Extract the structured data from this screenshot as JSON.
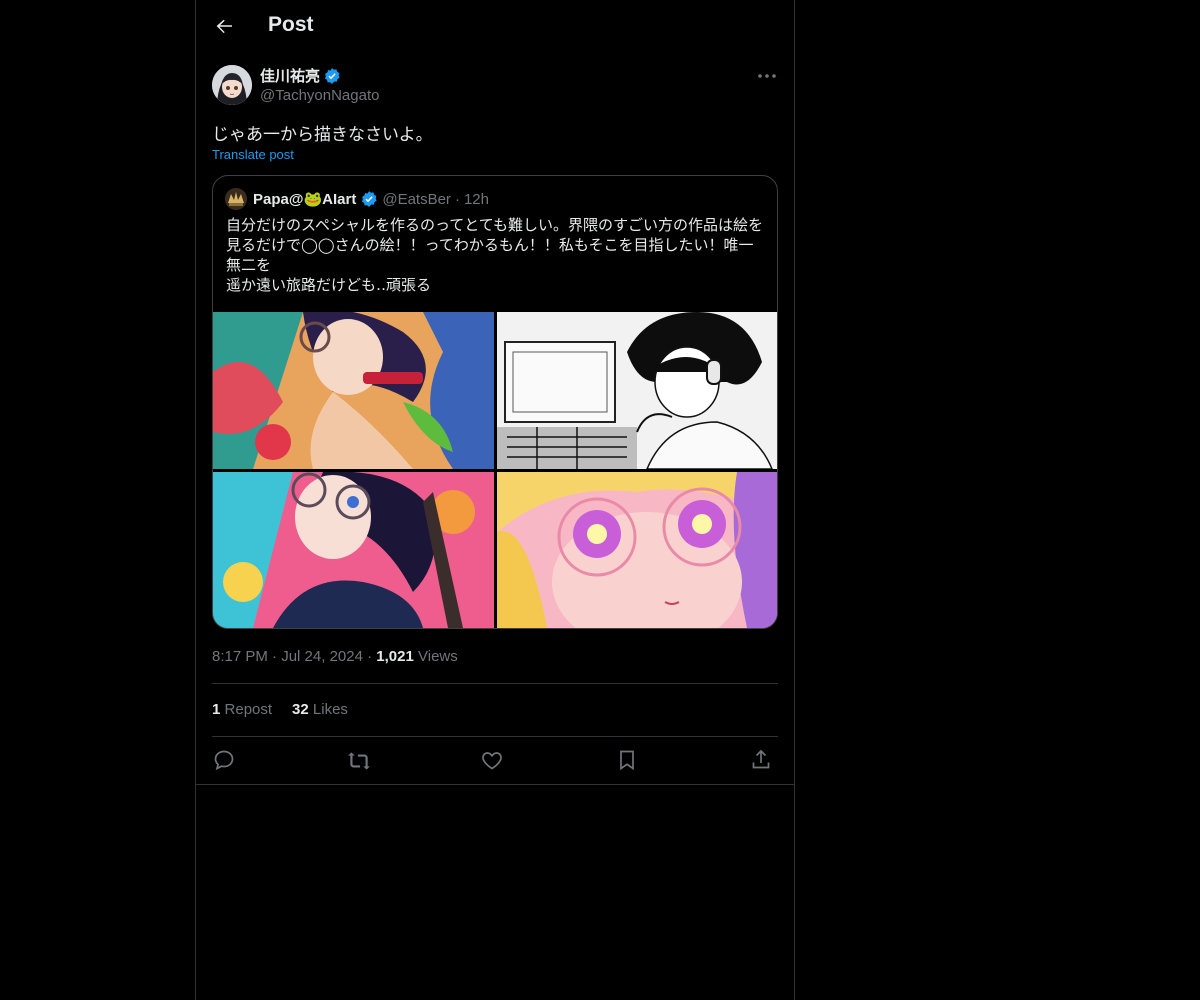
{
  "header": {
    "title": "Post",
    "back_icon": "arrow-left-icon"
  },
  "post": {
    "author_name": "佳川祐亮",
    "author_handle": "@TachyonNagato",
    "text": "じゃあ一から描きなさいよ。",
    "translate_label": "Translate post",
    "time": "8:17 PM",
    "date": "Jul 24, 2024",
    "views_count": "1,021",
    "views_label": "Views",
    "reposts_count": "1",
    "reposts_label": "Repost",
    "likes_count": "32",
    "likes_label": "Likes"
  },
  "quote": {
    "name": "Papa@🐸AIart",
    "handle": "@EatsBer",
    "time": "12h",
    "text": "自分だけのスペシャルを作るのってとても難しい。界隈のすごい方の作品は絵を見るだけで◯◯さんの絵！！ってわかるもん！！私もそこを目指したい！唯一無二を\n遥か遠い旅路だけども‥頑張る"
  },
  "separators": {
    "dot": "·"
  },
  "colors": {
    "accent": "#1d9bf0",
    "text": "#e7e9ea",
    "muted": "#71767b",
    "border": "#2f3336",
    "background": "#000000"
  },
  "actions": [
    "reply-icon",
    "repost-icon",
    "like-icon",
    "bookmark-icon",
    "share-icon"
  ]
}
